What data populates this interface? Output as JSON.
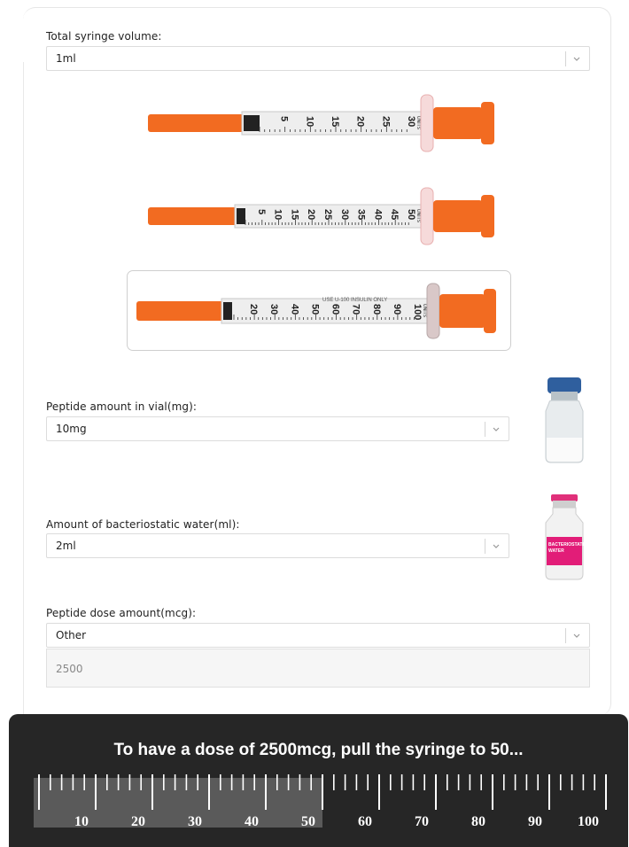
{
  "syringe_volume": {
    "label": "Total syringe volume:",
    "value": "1ml"
  },
  "syringe_options": [
    {
      "name": "syringe-0.3ml",
      "tick_labels": [
        "5",
        "10",
        "15",
        "20",
        "25",
        "30"
      ],
      "unit": "UNITS"
    },
    {
      "name": "syringe-0.5ml",
      "tick_labels": [
        "5",
        "10",
        "15",
        "20",
        "25",
        "30",
        "35",
        "40",
        "45",
        "50"
      ],
      "unit": "UNITS"
    },
    {
      "name": "syringe-1ml",
      "tick_labels": [
        "20",
        "30",
        "40",
        "50",
        "60",
        "70",
        "80",
        "90",
        "100"
      ],
      "unit": "UNITS",
      "top_text": "USE U-100 INSULIN ONLY"
    }
  ],
  "peptide_amount": {
    "label": "Peptide amount in vial(mg):",
    "value": "10mg"
  },
  "water_amount": {
    "label": "Amount of bacteriostatic water(ml):",
    "value": "2ml",
    "vial_label": [
      "BACTERIOSTATIC",
      "WATER"
    ]
  },
  "dose_amount": {
    "label": "Peptide dose amount(mcg):",
    "value": "Other",
    "custom_value": "2500"
  },
  "result": {
    "message": "To have a dose of 2500mcg, pull the syringe to 50...",
    "fill_units": 50,
    "max_units": 100,
    "scale_labels": [
      "10",
      "20",
      "30",
      "40",
      "50",
      "60",
      "70",
      "80",
      "90",
      "100"
    ]
  },
  "colors": {
    "accent": "#f26b21",
    "panel": "#262626",
    "fill": "#5a5a5a"
  }
}
